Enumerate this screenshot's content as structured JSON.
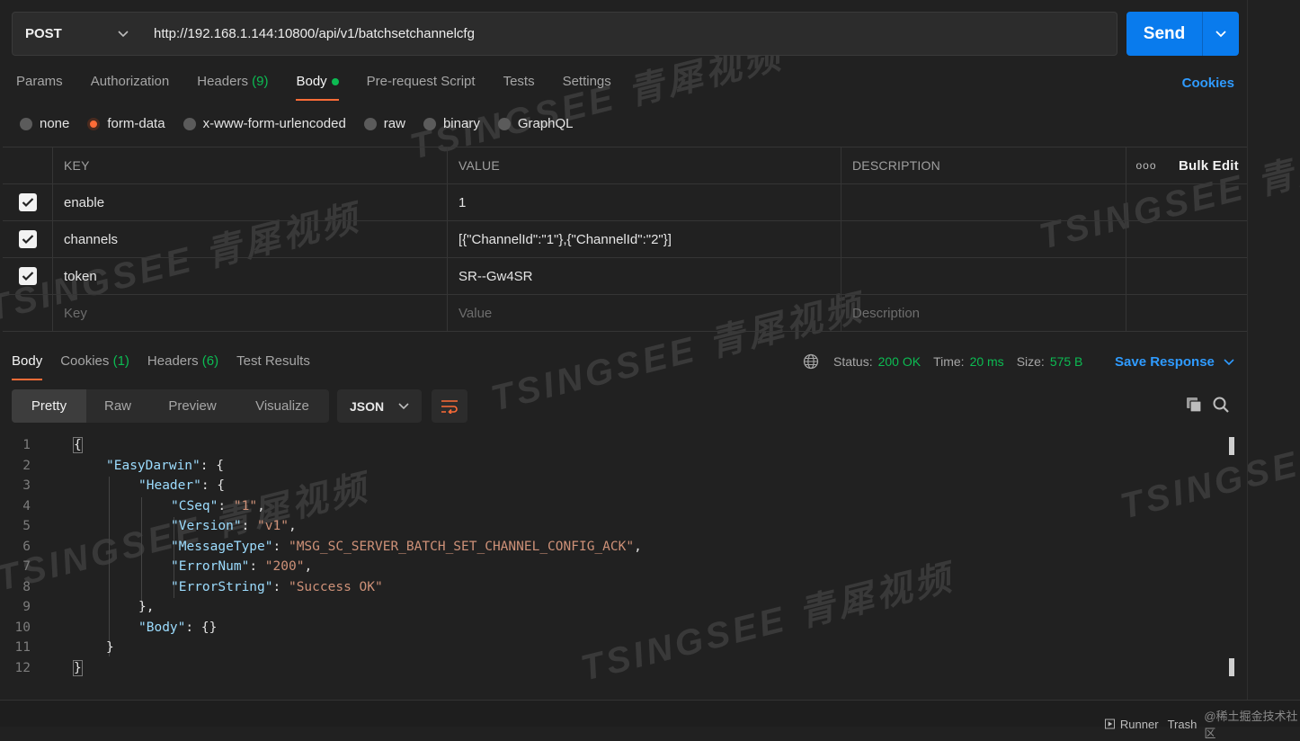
{
  "request": {
    "method": "POST",
    "url": "http://192.168.1.144:10800/api/v1/batchsetchannelcfg",
    "send_label": "Send"
  },
  "request_tabs": {
    "params": "Params",
    "authorization": "Authorization",
    "headers": "Headers",
    "headers_count": "(9)",
    "body": "Body",
    "prerequest": "Pre-request Script",
    "tests": "Tests",
    "settings": "Settings",
    "cookies": "Cookies"
  },
  "body_modes": {
    "none": "none",
    "form_data": "form-data",
    "urlencoded": "x-www-form-urlencoded",
    "raw": "raw",
    "binary": "binary",
    "graphql": "GraphQL"
  },
  "params_table": {
    "headers": {
      "key": "KEY",
      "value": "VALUE",
      "description": "DESCRIPTION",
      "bulk_edit": "Bulk Edit",
      "more": "ooo"
    },
    "rows": [
      {
        "key": "enable",
        "value": "1"
      },
      {
        "key": "channels",
        "value": "[{\"ChannelId\":\"1\"},{\"ChannelId\":\"2\"}]"
      },
      {
        "key": "token",
        "value": "SR--Gw4SR"
      }
    ],
    "placeholder": {
      "key": "Key",
      "value": "Value",
      "description": "Description"
    }
  },
  "response_tabs": {
    "body": "Body",
    "cookies": "Cookies",
    "cookies_count": "(1)",
    "headers": "Headers",
    "headers_count": "(6)",
    "test_results": "Test Results"
  },
  "response_status": {
    "status_label": "Status:",
    "status_value": "200 OK",
    "time_label": "Time:",
    "time_value": "20 ms",
    "size_label": "Size:",
    "size_value": "575 B",
    "save_response": "Save Response"
  },
  "view_modes": {
    "pretty": "Pretty",
    "raw": "Raw",
    "preview": "Preview",
    "visualize": "Visualize",
    "format": "JSON"
  },
  "code": {
    "line_numbers": [
      "1",
      "2",
      "3",
      "4",
      "5",
      "6",
      "7",
      "8",
      "9",
      "10",
      "11",
      "12"
    ],
    "k_easydarwin": "\"EasyDarwin\"",
    "k_header": "\"Header\"",
    "k_cseq": "\"CSeq\"",
    "v_cseq": "\"1\"",
    "k_version": "\"Version\"",
    "v_version": "\"v1\"",
    "k_messagetype": "\"MessageType\"",
    "v_messagetype": "\"MSG_SC_SERVER_BATCH_SET_CHANNEL_CONFIG_ACK\"",
    "k_errornum": "\"ErrorNum\"",
    "v_errornum": "\"200\"",
    "k_errorstring": "\"ErrorString\"",
    "v_errorstring": "\"Success OK\"",
    "k_body": "\"Body\""
  },
  "footer": {
    "runner": "Runner",
    "trash": "Trash",
    "community": "@稀土掘金技术社区"
  },
  "watermark": "TSINGSEE 青犀视频",
  "colors": {
    "accent": "#ff6c37",
    "primary": "#097bed",
    "success": "#0cbb52",
    "link": "#2f9bff"
  }
}
